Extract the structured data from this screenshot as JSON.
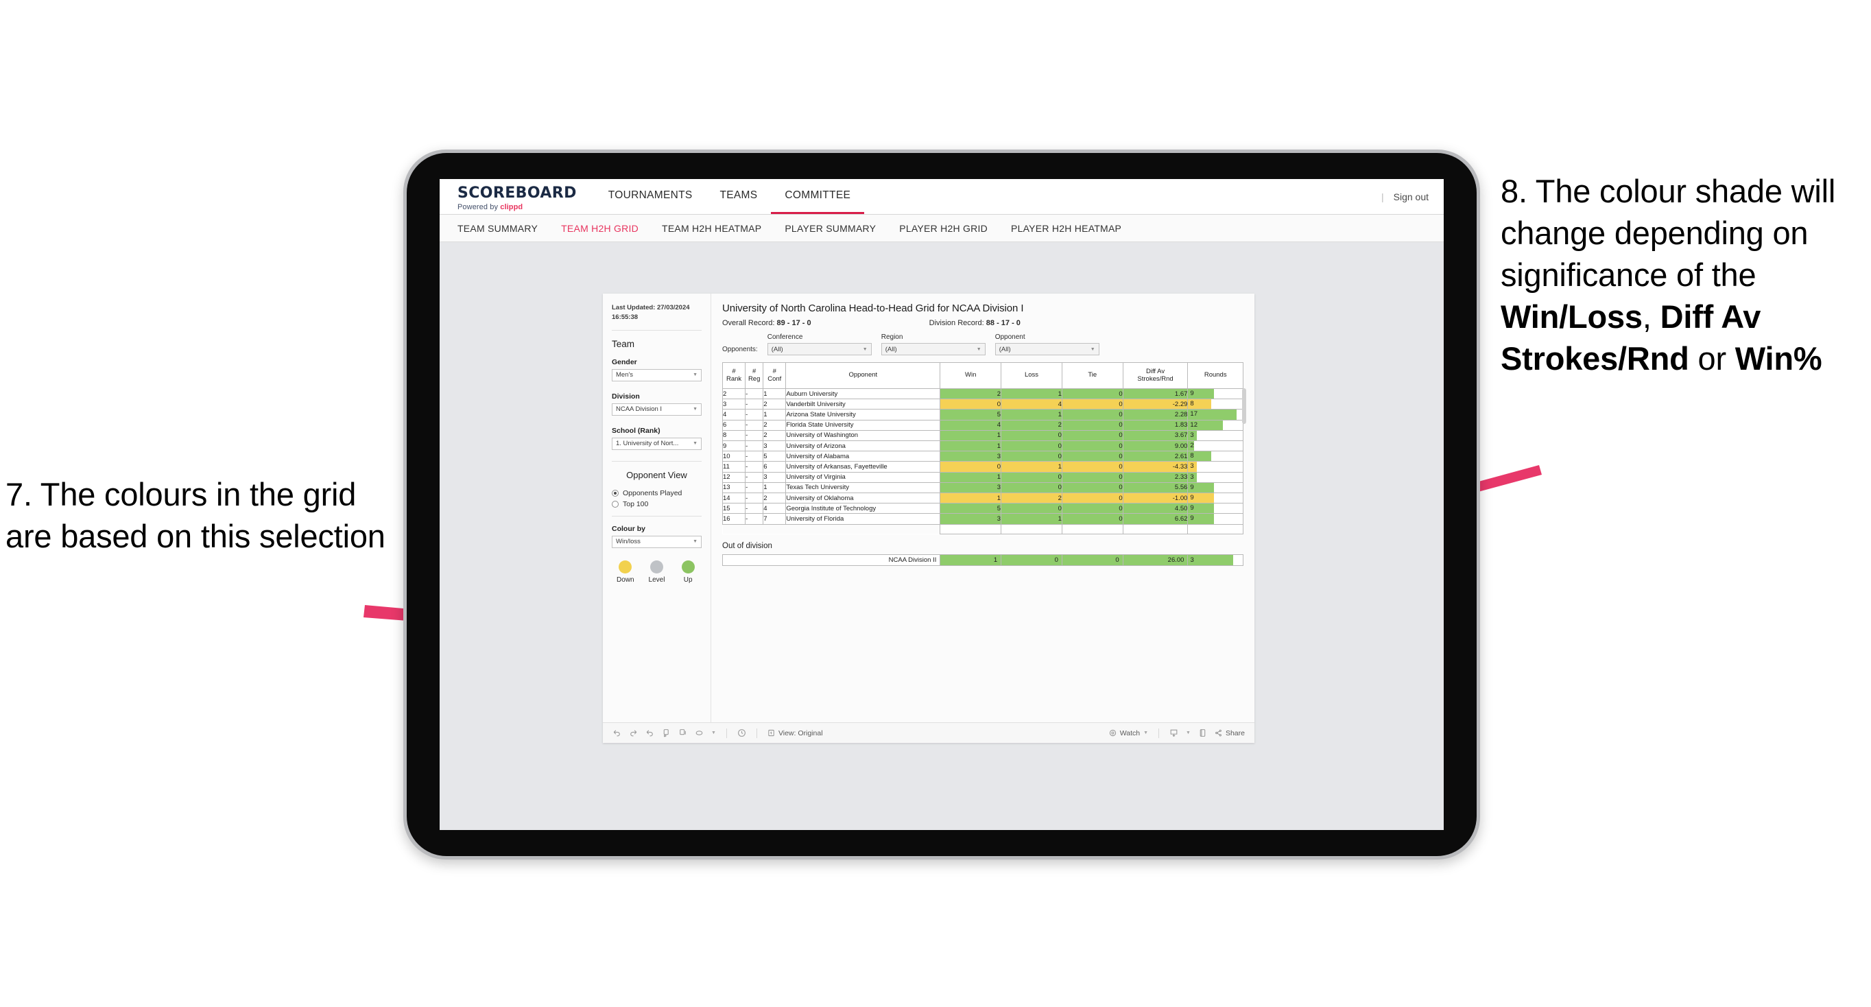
{
  "annotations": {
    "left": {
      "number": "7.",
      "text": "7. The colours in the grid are based on this selection"
    },
    "right": {
      "parts": [
        {
          "text": "8. The colour shade will change depending on significance of the ",
          "bold": false
        },
        {
          "text": "Win/Loss",
          "bold": true
        },
        {
          "text": ", ",
          "bold": false
        },
        {
          "text": "Diff Av Strokes/Rnd",
          "bold": true
        },
        {
          "text": " or ",
          "bold": false
        },
        {
          "text": "Win%",
          "bold": true
        }
      ]
    },
    "arrow_color": "#E8386A"
  },
  "app": {
    "brand": {
      "title": "SCOREBOARD",
      "powered_prefix": "Powered by ",
      "powered_name": "clippd"
    },
    "top_nav": [
      {
        "label": "TOURNAMENTS",
        "active": false
      },
      {
        "label": "TEAMS",
        "active": false
      },
      {
        "label": "COMMITTEE",
        "active": true
      }
    ],
    "sign_out": "Sign out",
    "separator": "|",
    "sub_nav": [
      {
        "label": "TEAM SUMMARY",
        "active": false
      },
      {
        "label": "TEAM H2H GRID",
        "active": true
      },
      {
        "label": "TEAM H2H HEATMAP",
        "active": false
      },
      {
        "label": "PLAYER SUMMARY",
        "active": false
      },
      {
        "label": "PLAYER H2H GRID",
        "active": false
      },
      {
        "label": "PLAYER H2H HEATMAP",
        "active": false
      }
    ],
    "accent_color": "#E8355F"
  },
  "sidebar": {
    "last_updated_label": "Last Updated:",
    "last_updated_date": "27/03/2024",
    "last_updated_time": "16:55:38",
    "team_heading": "Team",
    "fields": [
      {
        "label": "Gender",
        "value": "Men's"
      },
      {
        "label": "Division",
        "value": "NCAA Division I"
      },
      {
        "label": "School (Rank)",
        "value": "1. University of Nort..."
      }
    ],
    "opponent_view": {
      "heading": "Opponent View",
      "options": [
        {
          "label": "Opponents Played",
          "selected": true
        },
        {
          "label": "Top 100",
          "selected": false
        }
      ]
    },
    "colour_by": {
      "label": "Colour by",
      "value": "Win/loss"
    },
    "legend": [
      {
        "label": "Down",
        "color": "#F2D14E"
      },
      {
        "label": "Level",
        "color": "#BFC2C6"
      },
      {
        "label": "Up",
        "color": "#8CC462"
      }
    ]
  },
  "main": {
    "title": "University of North Carolina Head-to-Head Grid for NCAA Division I",
    "overall_record_label": "Overall Record:",
    "overall_record_value": "89 - 17 - 0",
    "division_record_label": "Division Record:",
    "division_record_value": "88 - 17 - 0",
    "opponents_label": "Opponents:",
    "filters": [
      {
        "label": "Conference",
        "value": "(All)"
      },
      {
        "label": "Region",
        "value": "(All)"
      },
      {
        "label": "Opponent",
        "value": "(All)"
      }
    ],
    "table": {
      "headers": [
        "#\nRank",
        "#\nReg",
        "#\nConf",
        "Opponent",
        "Win",
        "Loss",
        "Tie",
        "Diff Av\nStrokes/Rnd",
        "Rounds"
      ],
      "header_lines": [
        [
          "#",
          "Rank"
        ],
        [
          "#",
          "Reg"
        ],
        [
          "#",
          "Conf"
        ],
        [
          "Opponent"
        ],
        [
          "Win"
        ],
        [
          "Loss"
        ],
        [
          "Tie"
        ],
        [
          "Diff Av",
          "Strokes/Rnd"
        ],
        [
          "Rounds"
        ]
      ],
      "rows": [
        {
          "rank": "2",
          "reg": "-",
          "conf": "1",
          "opponent": "Auburn University",
          "win": "2",
          "loss": "1",
          "tie": "0",
          "diff": "1.67",
          "rounds": "9",
          "tone": "up",
          "bar_pct": 47
        },
        {
          "rank": "3",
          "reg": "-",
          "conf": "2",
          "opponent": "Vanderbilt University",
          "win": "0",
          "loss": "4",
          "tie": "0",
          "diff": "-2.29",
          "rounds": "8",
          "tone": "down",
          "bar_pct": 42
        },
        {
          "rank": "4",
          "reg": "-",
          "conf": "1",
          "opponent": "Arizona State University",
          "win": "5",
          "loss": "1",
          "tie": "0",
          "diff": "2.28",
          "rounds": "17",
          "tone": "up",
          "bar_pct": 89
        },
        {
          "rank": "6",
          "reg": "-",
          "conf": "2",
          "opponent": "Florida State University",
          "win": "4",
          "loss": "2",
          "tie": "0",
          "diff": "1.83",
          "rounds": "12",
          "tone": "up",
          "bar_pct": 63
        },
        {
          "rank": "8",
          "reg": "-",
          "conf": "2",
          "opponent": "University of Washington",
          "win": "1",
          "loss": "0",
          "tie": "0",
          "diff": "3.67",
          "rounds": "3",
          "tone": "up",
          "bar_pct": 16
        },
        {
          "rank": "9",
          "reg": "-",
          "conf": "3",
          "opponent": "University of Arizona",
          "win": "1",
          "loss": "0",
          "tie": "0",
          "diff": "9.00",
          "rounds": "2",
          "tone": "up",
          "bar_pct": 11
        },
        {
          "rank": "10",
          "reg": "-",
          "conf": "5",
          "opponent": "University of Alabama",
          "win": "3",
          "loss": "0",
          "tie": "0",
          "diff": "2.61",
          "rounds": "8",
          "tone": "up",
          "bar_pct": 42
        },
        {
          "rank": "11",
          "reg": "-",
          "conf": "6",
          "opponent": "University of Arkansas, Fayetteville",
          "win": "0",
          "loss": "1",
          "tie": "0",
          "diff": "-4.33",
          "rounds": "3",
          "tone": "down",
          "bar_pct": 16
        },
        {
          "rank": "12",
          "reg": "-",
          "conf": "3",
          "opponent": "University of Virginia",
          "win": "1",
          "loss": "0",
          "tie": "0",
          "diff": "2.33",
          "rounds": "3",
          "tone": "up",
          "bar_pct": 16
        },
        {
          "rank": "13",
          "reg": "-",
          "conf": "1",
          "opponent": "Texas Tech University",
          "win": "3",
          "loss": "0",
          "tie": "0",
          "diff": "5.56",
          "rounds": "9",
          "tone": "up",
          "bar_pct": 47
        },
        {
          "rank": "14",
          "reg": "-",
          "conf": "2",
          "opponent": "University of Oklahoma",
          "win": "1",
          "loss": "2",
          "tie": "0",
          "diff": "-1.00",
          "rounds": "9",
          "tone": "down",
          "bar_pct": 47
        },
        {
          "rank": "15",
          "reg": "-",
          "conf": "4",
          "opponent": "Georgia Institute of Technology",
          "win": "5",
          "loss": "0",
          "tie": "0",
          "diff": "4.50",
          "rounds": "9",
          "tone": "up",
          "bar_pct": 47
        },
        {
          "rank": "16",
          "reg": "-",
          "conf": "7",
          "opponent": "University of Florida",
          "win": "3",
          "loss": "1",
          "tie": "0",
          "diff": "6.62",
          "rounds": "9",
          "tone": "up",
          "bar_pct": 47
        }
      ]
    },
    "out_of_division": {
      "title": "Out of division",
      "row": {
        "label": "NCAA Division II",
        "win": "1",
        "loss": "0",
        "tie": "0",
        "diff": "26.00",
        "rounds": "3",
        "tone": "up",
        "bar_pct": 82
      }
    }
  },
  "toolbar": {
    "view_label": "View: Original",
    "watch_label": "Watch",
    "share_label": "Share",
    "icons": [
      "undo-icon",
      "redo-icon",
      "revert-icon",
      "pause-icon",
      "resume-icon",
      "refresh-icon",
      "dropdown-caret-icon",
      "clock-icon",
      "view-icon",
      "watch-icon",
      "download-icon",
      "fullscreen-icon",
      "share-icon"
    ]
  },
  "colors": {
    "green": "#8FCC6B",
    "yellow": "#F5D155",
    "grey": "#BFC2C6",
    "accent": "#E8355F",
    "arrow": "#E8386A"
  }
}
